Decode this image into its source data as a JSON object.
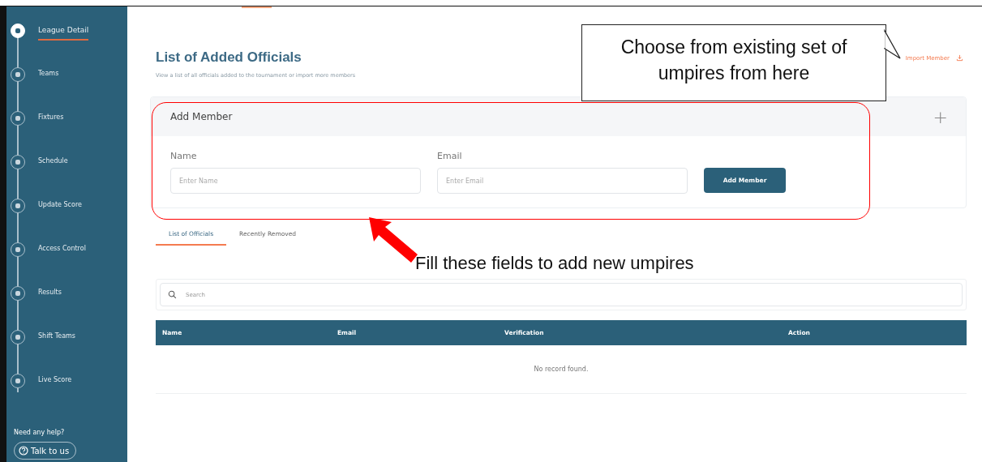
{
  "sidebar": {
    "items": [
      {
        "label": "League Detail",
        "selected": true
      },
      {
        "label": "Teams",
        "selected": false
      },
      {
        "label": "Fixtures",
        "selected": false
      },
      {
        "label": "Schedule",
        "selected": false
      },
      {
        "label": "Update Score",
        "selected": false
      },
      {
        "label": "Access Control",
        "selected": false
      },
      {
        "label": "Results",
        "selected": false
      },
      {
        "label": "Shift Teams",
        "selected": false
      },
      {
        "label": "Live Score",
        "selected": false
      }
    ],
    "help_text": "Need any help?",
    "help_button": "Talk to us"
  },
  "header": {
    "title": "List of Added Officials",
    "subtitle": "View a list of all officials added to the tournament or import more members",
    "import_link": "Import Member"
  },
  "add_member": {
    "title": "Add Member",
    "expand_icon": "+",
    "fields": [
      {
        "label": "Name",
        "placeholder": "Enter Name"
      },
      {
        "label": "Email",
        "placeholder": "Enter Email"
      }
    ],
    "button": "Add Member"
  },
  "tabs": [
    {
      "label": "List of Officials",
      "selected": true
    },
    {
      "label": "Recently Removed",
      "selected": false
    }
  ],
  "search": {
    "placeholder": "Search"
  },
  "table": {
    "columns": [
      "Name",
      "Email",
      "Verification",
      "Action"
    ],
    "empty_text": "No record found."
  },
  "annotations": [
    {
      "kind": "callout",
      "text": "Choose from existing set of umpires from here"
    },
    {
      "kind": "highlight"
    },
    {
      "kind": "arrow_note",
      "text": "Fill these fields to add new umpires"
    }
  ]
}
